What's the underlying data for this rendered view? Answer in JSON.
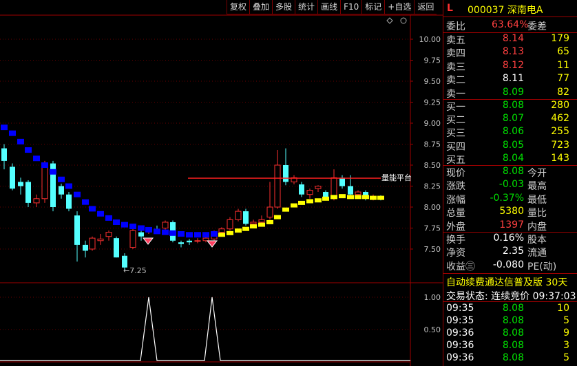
{
  "toolbar": [
    "复权",
    "叠加",
    "多股",
    "统计",
    "画线",
    "F10",
    "标记",
    "+自选",
    "返回"
  ],
  "chart": {
    "price_ticks": [
      "10.00",
      "9.75",
      "9.50",
      "9.25",
      "9.00",
      "8.75",
      "8.50",
      "8.25",
      "8.00",
      "7.75",
      "7.50"
    ],
    "low_marker": "←7.25",
    "line_label": "量能平台",
    "ind_ticks": [
      "1.00",
      "0.50"
    ]
  },
  "quote": {
    "market": "L",
    "code_name": "000037 深南电A",
    "weibi_label": "委比",
    "weibi_value": "63.64%",
    "weicha_label": "委差",
    "sell": [
      {
        "label": "卖五",
        "price": "8.14",
        "vol": "179"
      },
      {
        "label": "卖四",
        "price": "8.13",
        "vol": "65"
      },
      {
        "label": "卖三",
        "price": "8.12",
        "vol": "11"
      },
      {
        "label": "卖二",
        "price": "8.11",
        "vol": "77"
      },
      {
        "label": "卖一",
        "price": "8.09",
        "vol": "82"
      }
    ],
    "buy": [
      {
        "label": "买一",
        "price": "8.08",
        "vol": "280"
      },
      {
        "label": "买二",
        "price": "8.07",
        "vol": "462"
      },
      {
        "label": "买三",
        "price": "8.06",
        "vol": "255"
      },
      {
        "label": "买四",
        "price": "8.05",
        "vol": "723"
      },
      {
        "label": "买五",
        "price": "8.04",
        "vol": "143"
      }
    ],
    "stats": [
      {
        "l1": "现价",
        "v1": "8.08",
        "l2": "今开"
      },
      {
        "l1": "涨跌",
        "v1": "-0.03",
        "l2": "最高"
      },
      {
        "l1": "涨幅",
        "v1": "-0.37%",
        "l2": "最低"
      },
      {
        "l1": "总量",
        "v1": "5380",
        "l2": "量比"
      },
      {
        "l1": "外盘",
        "v1": "1397",
        "l2": "内盘"
      }
    ],
    "stats2": [
      {
        "l1": "换手",
        "v1": "0.16%",
        "l2": "股本"
      },
      {
        "l1": "净资",
        "v1": "2.35",
        "l2": "流通"
      },
      {
        "l1": "收益㊂",
        "v1": "-0.080",
        "l2": "PE(动)"
      }
    ],
    "banner": "自动续费通达信普及版 30天",
    "trade_status": "交易状态: 连续竞价 09:37:03",
    "ticks": [
      {
        "time": "09:35",
        "price": "8.08",
        "vol": "10"
      },
      {
        "time": "09:35",
        "price": "8.08",
        "vol": "5"
      },
      {
        "time": "09:36",
        "price": "8.08",
        "vol": "9"
      },
      {
        "time": "09:36",
        "price": "8.08",
        "vol": "3"
      },
      {
        "time": "09:36",
        "price": "8.08",
        "vol": "5"
      }
    ]
  }
}
